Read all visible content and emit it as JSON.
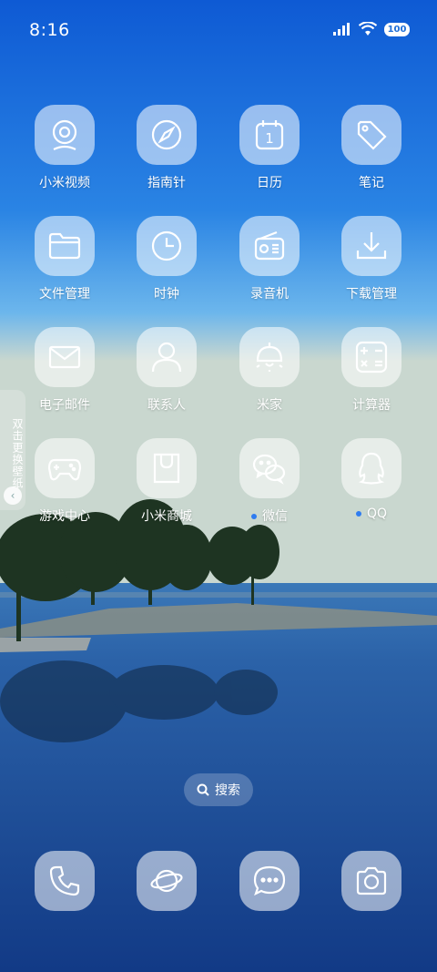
{
  "status_bar": {
    "time": "8:16",
    "battery": "100"
  },
  "apps": [
    {
      "label": "小米视频",
      "icon": "camera-lens-icon",
      "dot": false
    },
    {
      "label": "指南针",
      "icon": "compass-icon",
      "dot": false
    },
    {
      "label": "日历",
      "icon": "calendar-icon",
      "dot": false,
      "icon_text": "1"
    },
    {
      "label": "笔记",
      "icon": "tag-icon",
      "dot": false
    },
    {
      "label": "文件管理",
      "icon": "folder-icon",
      "dot": false
    },
    {
      "label": "时钟",
      "icon": "clock-icon",
      "dot": false
    },
    {
      "label": "录音机",
      "icon": "radio-icon",
      "dot": false
    },
    {
      "label": "下载管理",
      "icon": "download-icon",
      "dot": false
    },
    {
      "label": "电子邮件",
      "icon": "mail-icon",
      "dot": false
    },
    {
      "label": "联系人",
      "icon": "person-icon",
      "dot": false
    },
    {
      "label": "米家",
      "icon": "lamp-icon",
      "dot": false
    },
    {
      "label": "计算器",
      "icon": "calculator-icon",
      "dot": false
    },
    {
      "label": "游戏中心",
      "icon": "gamepad-icon",
      "dot": false
    },
    {
      "label": "小米商城",
      "icon": "shopping-bag-icon",
      "dot": false
    },
    {
      "label": "微信",
      "icon": "wechat-icon",
      "dot": true
    },
    {
      "label": "QQ",
      "icon": "qq-penguin-icon",
      "dot": true
    }
  ],
  "side_tab": {
    "text": "双击更换壁纸"
  },
  "search": {
    "label": "搜索"
  },
  "dock": [
    {
      "icon": "phone-icon"
    },
    {
      "icon": "browser-planet-icon"
    },
    {
      "icon": "message-icon"
    },
    {
      "icon": "camera-icon"
    }
  ],
  "colors": {
    "sky_top": "#0f5fd6",
    "sky_mid": "#4fa4e8",
    "water": "#1d4f9a",
    "accent_dot": "#2f7cf0"
  }
}
